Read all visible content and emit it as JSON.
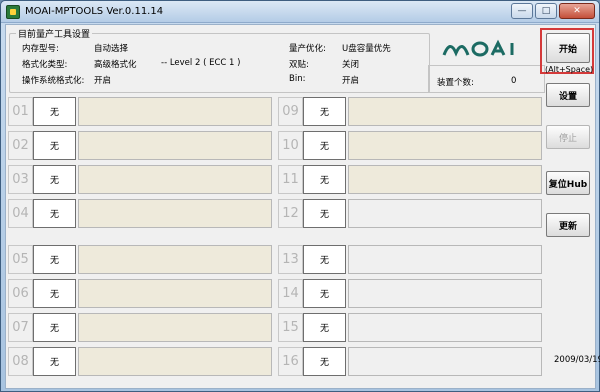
{
  "window": {
    "title": "MOAI-MPTOOLS Ver.0.11.14"
  },
  "settings": {
    "group_title": "目前量产工具设置",
    "memory_type_label": "内存型号:",
    "memory_type_value": "自动选择",
    "format_type_label": "格式化类型:",
    "format_type_value": "高级格式化",
    "format_level": "-- Level 2 ( ECC 1 )",
    "os_format_label": "操作系统格式化:",
    "os_format_value": "开启",
    "optimize_label": "量产优化:",
    "optimize_value": "U盘容量优先",
    "dual_label": "双贴:",
    "dual_value": "关闭",
    "bin_label": "Bin:",
    "bin_value": "开启"
  },
  "logo": {
    "text": "MOAI"
  },
  "device_count": {
    "label": "装置个数:",
    "value": "0"
  },
  "buttons": {
    "start": "开始",
    "start_hint": "(Alt+Space)",
    "settings": "设置",
    "stop": "停止",
    "reset_hub": "复位Hub",
    "update": "更新"
  },
  "date": "2009/03/19",
  "slots_left": [
    {
      "num": "01",
      "state": "无"
    },
    {
      "num": "02",
      "state": "无"
    },
    {
      "num": "03",
      "state": "无"
    },
    {
      "num": "04",
      "state": "无"
    },
    {
      "num": "05",
      "state": "无"
    },
    {
      "num": "06",
      "state": "无"
    },
    {
      "num": "07",
      "state": "无"
    },
    {
      "num": "08",
      "state": "无"
    }
  ],
  "slots_right": [
    {
      "num": "09",
      "state": "无"
    },
    {
      "num": "10",
      "state": "无"
    },
    {
      "num": "11",
      "state": "无"
    },
    {
      "num": "12",
      "state": "无"
    },
    {
      "num": "13",
      "state": "无"
    },
    {
      "num": "14",
      "state": "无"
    },
    {
      "num": "15",
      "state": "无"
    },
    {
      "num": "16",
      "state": "无"
    }
  ]
}
